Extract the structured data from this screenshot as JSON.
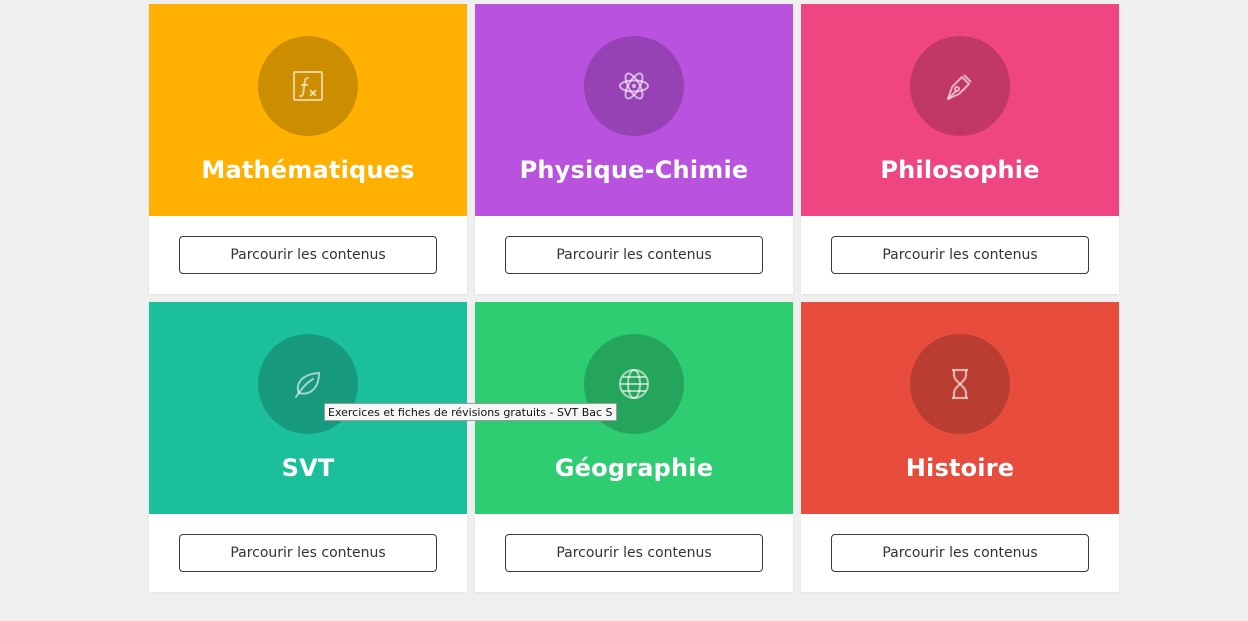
{
  "cards": [
    {
      "title": "Mathématiques",
      "button_label": "Parcourir les contenus",
      "icon": "function-fx-icon",
      "color": "#ffb000",
      "circle_color": "#cc8d00"
    },
    {
      "title": "Physique-Chimie",
      "button_label": "Parcourir les contenus",
      "icon": "atom-icon",
      "color": "#ba52e0",
      "circle_color": "#9641b4"
    },
    {
      "title": "Philosophie",
      "button_label": "Parcourir les contenus",
      "icon": "fountain-pen-icon",
      "color": "#ef4681",
      "circle_color": "#c13868"
    },
    {
      "title": "SVT",
      "button_label": "Parcourir les contenus",
      "icon": "leaf-icon",
      "color": "#1bbf9b",
      "circle_color": "#16997c"
    },
    {
      "title": "Géographie",
      "button_label": "Parcourir les contenus",
      "icon": "globe-icon",
      "color": "#2ecd72",
      "circle_color": "#25a45b"
    },
    {
      "title": "Histoire",
      "button_label": "Parcourir les contenus",
      "icon": "hourglass-icon",
      "color": "#e74c3c",
      "circle_color": "#b93d30"
    }
  ],
  "tooltip": {
    "text": "Exercices et fiches de révisions gratuits - SVT Bac S"
  }
}
